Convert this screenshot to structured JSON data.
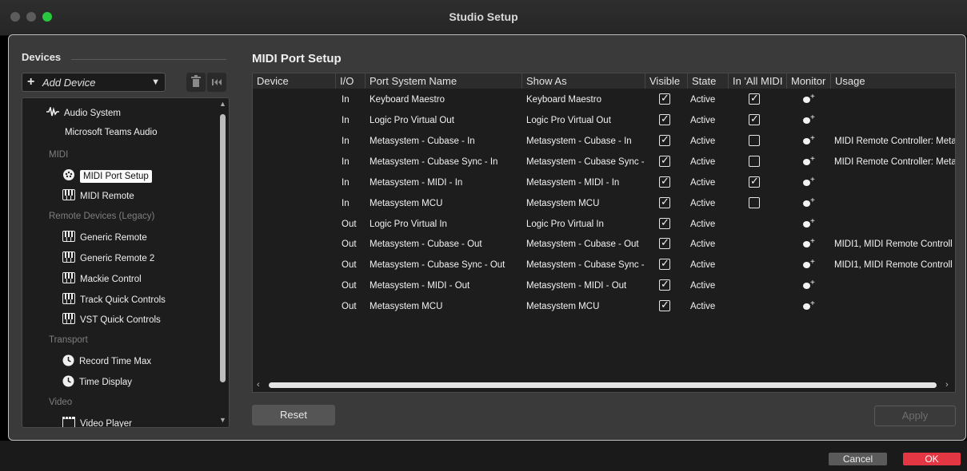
{
  "window": {
    "title": "Studio Setup"
  },
  "devices_panel": {
    "header": "Devices",
    "add_device": "Add Device",
    "tree": [
      {
        "kind": "item",
        "label": "Audio System",
        "icon": "waveform-icon",
        "indent": 1
      },
      {
        "kind": "item",
        "label": "Microsoft Teams Audio",
        "icon": "",
        "indent": 2
      },
      {
        "kind": "category",
        "label": "MIDI"
      },
      {
        "kind": "item",
        "label": "MIDI Port Setup",
        "icon": "midi-port-icon",
        "indent": 2,
        "selected": true
      },
      {
        "kind": "item",
        "label": "MIDI Remote",
        "icon": "keyboard-icon",
        "indent": 2
      },
      {
        "kind": "category",
        "label": "Remote Devices (Legacy)"
      },
      {
        "kind": "item",
        "label": "Generic Remote",
        "icon": "keyboard-icon",
        "indent": 2
      },
      {
        "kind": "item",
        "label": "Generic Remote 2",
        "icon": "keyboard-icon",
        "indent": 2
      },
      {
        "kind": "item",
        "label": "Mackie Control",
        "icon": "keyboard-icon",
        "indent": 2
      },
      {
        "kind": "item",
        "label": "Track Quick Controls",
        "icon": "keyboard-icon",
        "indent": 2
      },
      {
        "kind": "item",
        "label": "VST Quick Controls",
        "icon": "keyboard-icon",
        "indent": 2
      },
      {
        "kind": "category",
        "label": "Transport"
      },
      {
        "kind": "item",
        "label": "Record Time Max",
        "icon": "clock-icon",
        "indent": 2
      },
      {
        "kind": "item",
        "label": "Time Display",
        "icon": "clock-icon",
        "indent": 2
      },
      {
        "kind": "category",
        "label": "Video"
      },
      {
        "kind": "item",
        "label": "Video Player",
        "icon": "video-icon",
        "indent": 2
      }
    ]
  },
  "midi_port_setup": {
    "title": "MIDI Port Setup",
    "columns": [
      "Device",
      "I/O",
      "Port System Name",
      "Show As",
      "Visible",
      "State",
      "In 'All MIDI",
      "Monitor",
      "Usage"
    ],
    "rows": [
      {
        "device": "",
        "io": "In",
        "port": "Keyboard Maestro",
        "show_as": "Keyboard Maestro",
        "visible": true,
        "state": "Active",
        "all_midi": true,
        "usage": ""
      },
      {
        "device": "",
        "io": "In",
        "port": "Logic Pro Virtual Out",
        "show_as": "Logic Pro Virtual Out",
        "visible": true,
        "state": "Active",
        "all_midi": true,
        "usage": ""
      },
      {
        "device": "",
        "io": "In",
        "port": "Metasystem - Cubase - In",
        "show_as": "Metasystem - Cubase - In",
        "visible": true,
        "state": "Active",
        "all_midi": false,
        "usage": "MIDI Remote Controller: Meta"
      },
      {
        "device": "",
        "io": "In",
        "port": "Metasystem - Cubase Sync - In",
        "show_as": "Metasystem - Cubase Sync -",
        "visible": true,
        "state": "Active",
        "all_midi": false,
        "usage": "MIDI Remote Controller: Meta"
      },
      {
        "device": "",
        "io": "In",
        "port": "Metasystem - MIDI - In",
        "show_as": "Metasystem - MIDI - In",
        "visible": true,
        "state": "Active",
        "all_midi": true,
        "usage": ""
      },
      {
        "device": "",
        "io": "In",
        "port": "Metasystem MCU",
        "show_as": "Metasystem MCU",
        "visible": true,
        "state": "Active",
        "all_midi": false,
        "usage": ""
      },
      {
        "device": "",
        "io": "Out",
        "port": "Logic Pro Virtual In",
        "show_as": "Logic Pro Virtual In",
        "visible": true,
        "state": "Active",
        "all_midi": null,
        "usage": ""
      },
      {
        "device": "",
        "io": "Out",
        "port": "Metasystem - Cubase - Out",
        "show_as": "Metasystem - Cubase - Out",
        "visible": true,
        "state": "Active",
        "all_midi": null,
        "usage": "MIDI1, MIDI Remote Controll"
      },
      {
        "device": "",
        "io": "Out",
        "port": "Metasystem - Cubase Sync - Out",
        "show_as": "Metasystem - Cubase Sync -",
        "visible": true,
        "state": "Active",
        "all_midi": null,
        "usage": "MIDI1, MIDI Remote Controll"
      },
      {
        "device": "",
        "io": "Out",
        "port": "Metasystem - MIDI - Out",
        "show_as": "Metasystem - MIDI - Out",
        "visible": true,
        "state": "Active",
        "all_midi": null,
        "usage": ""
      },
      {
        "device": "",
        "io": "Out",
        "port": "Metasystem MCU",
        "show_as": "Metasystem MCU",
        "visible": true,
        "state": "Active",
        "all_midi": null,
        "usage": ""
      }
    ],
    "reset": "Reset",
    "apply": "Apply"
  },
  "footer": {
    "cancel": "Cancel",
    "ok": "OK"
  },
  "colors": {
    "ok": "#e33743",
    "traffic_green": "#27c93f"
  }
}
